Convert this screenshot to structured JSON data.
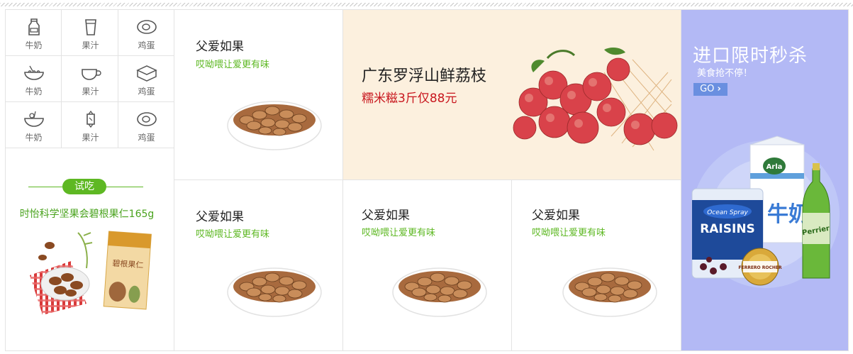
{
  "categories": [
    {
      "label": "牛奶",
      "icon": "milk-bottle-icon"
    },
    {
      "label": "果汁",
      "icon": "juice-cup-icon"
    },
    {
      "label": "鸡蛋",
      "icon": "egg-icon"
    },
    {
      "label": "牛奶",
      "icon": "noodle-bowl-icon"
    },
    {
      "label": "果汁",
      "icon": "coffee-cup-icon"
    },
    {
      "label": "鸡蛋",
      "icon": "cake-box-icon"
    },
    {
      "label": "牛奶",
      "icon": "salad-bowl-icon"
    },
    {
      "label": "果汁",
      "icon": "candy-icon"
    },
    {
      "label": "鸡蛋",
      "icon": "egg-icon"
    }
  ],
  "trial": {
    "badge": "试吃",
    "product_name": "时怡科学坚果会碧根果仁165g",
    "package_label": "碧根果仁"
  },
  "products": [
    {
      "title": "父爱如果",
      "subtitle": "哎呦喂让爱更有味"
    },
    {
      "title": "父爱如果",
      "subtitle": "哎呦喂让爱更有味"
    },
    {
      "title": "父爱如果",
      "subtitle": "哎呦喂让爱更有味"
    },
    {
      "title": "父爱如果",
      "subtitle": "哎呦喂让爱更有味"
    }
  ],
  "lychee_banner": {
    "title": "广东罗浮山鲜荔枝",
    "price_text": "糯米糍3斤仅88元"
  },
  "promo": {
    "title": "进口限时秒杀",
    "subtitle": "美食抢不停！",
    "go_label": "GO",
    "brand_carton": "Arla",
    "carton_text": "牛奶",
    "bag_brand": "Ocean Spray",
    "bag_text": "RAISINS",
    "bottle_brand": "Perrier",
    "chocolate_brand": "FERRERO ROCHER"
  },
  "colors": {
    "accent_green": "#5eb823",
    "price_red": "#c8171e",
    "lychee_bg": "#fcf0de",
    "promo_bg": "#b3b9f5"
  }
}
